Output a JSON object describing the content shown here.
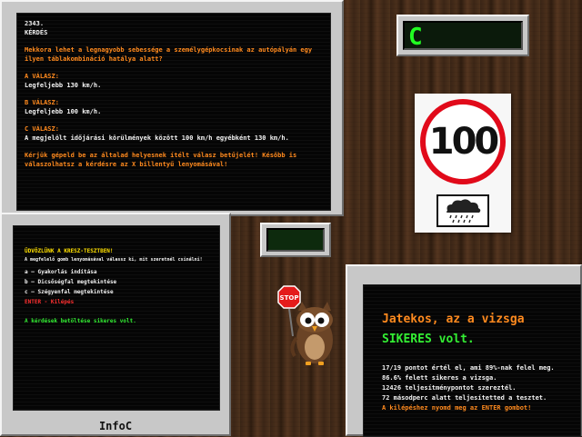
{
  "question": {
    "number": "2343.",
    "heading": "KÉRDÉS",
    "text": "Mekkora lehet a legnagyobb sebessége a személygépkocsinak az autópályán egy ilyen táblakombináció hatálya alatt?",
    "answers": [
      {
        "label": "A VÁLASZ:",
        "text": "Legfeljebb 130 km/h."
      },
      {
        "label": "B VÁLASZ:",
        "text": "Legfeljebb 100 km/h."
      },
      {
        "label": "C VÁLASZ:",
        "text": "A megjelölt időjárási körülmények között 100 km/h egyébként 130 km/h."
      }
    ],
    "instruction": "Kérjük gépeld be az általad helyesnek ítélt válasz betűjelét! Később is válaszolhatsz a kérdésre az X billentyű lenyomásával!"
  },
  "answer_display": {
    "value": "C"
  },
  "sign": {
    "speed_limit": "100",
    "icon": "rain-cloud-icon",
    "ring_color": "#e10a1a"
  },
  "intro": {
    "greeting": "ÜDVÖZLÜNK A KRESZ-TESZTBEN!",
    "subtitle": "A megfelelő gomb lenyomásával válassz ki, mit szeretnél csinálni!",
    "menu": [
      {
        "key": "a",
        "label": "Gyakorlás indítása"
      },
      {
        "key": "b",
        "label": "Dicsőségfal megtekintése"
      },
      {
        "key": "c",
        "label": "Szégyenfal megtekintése"
      }
    ],
    "exit_label": "ENTER - Kilépés",
    "load_status": "A kérdések betöltése sikeres volt."
  },
  "brand": "InfoC",
  "stop_sign_text": "STOP",
  "result": {
    "title": "Jatekos, az a vizsga",
    "status": "SIKERES volt.",
    "lines": [
      "17/19 pontot értél el, ami 89%-nak felel meg.",
      "86.6% felett sikeres a vizsga.",
      "12426 teljesítménypontot szereztél.",
      "72 másodperc alatt teljesítetted a tesztet."
    ],
    "prompt": "A kilépéshez nyomd meg az ENTER gombot!"
  },
  "colors": {
    "accent_orange": "#ff8a1e",
    "success_green": "#33ee33",
    "error_red": "#ff3030",
    "highlight_yellow": "#ffe000",
    "display_green": "#22ff22"
  }
}
